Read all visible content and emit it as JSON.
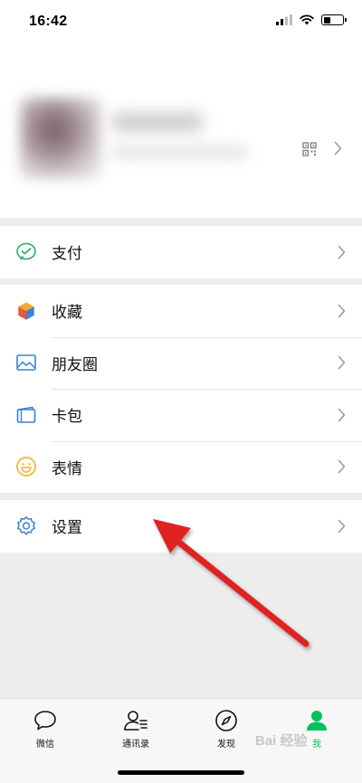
{
  "status_bar": {
    "time": "16:42"
  },
  "profile": {},
  "menu": {
    "pay": {
      "label": "支付",
      "icon": "wechat-pay-icon"
    },
    "favorites": {
      "label": "收藏",
      "icon": "cube-icon"
    },
    "moments": {
      "label": "朋友圈",
      "icon": "image-icon"
    },
    "cards": {
      "label": "卡包",
      "icon": "card-icon"
    },
    "stickers": {
      "label": "表情",
      "icon": "smiley-icon"
    },
    "settings": {
      "label": "设置",
      "icon": "gear-icon"
    }
  },
  "tabbar": {
    "chats": "微信",
    "contacts": "通讯录",
    "discover": "发现",
    "me": "我"
  },
  "watermark": "Bai 经验",
  "colors": {
    "accent": "#07c160",
    "background": "#ededed",
    "annotation_arrow": "#e02020"
  }
}
